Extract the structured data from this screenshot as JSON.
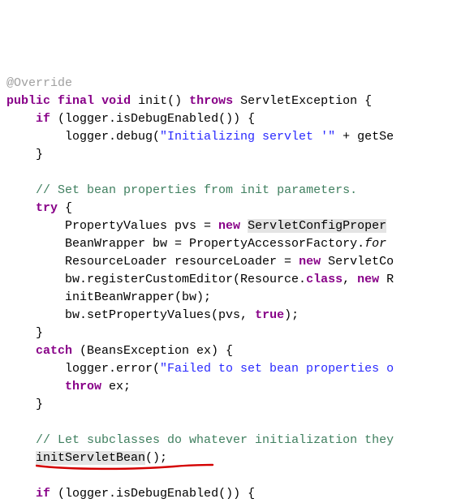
{
  "code": {
    "l1_ann": "@Override",
    "l2_a": "public",
    "l2_b": "final",
    "l2_c": "void",
    "l2_d": " init() ",
    "l2_e": "throws",
    "l2_f": " ServletException {",
    "l3_a": "if",
    "l3_b": " (logger.isDebugEnabled()) {",
    "l4_a": "        logger.debug(",
    "l4_s": "\"Initializing servlet '\"",
    "l4_b": " + getSe",
    "l5": "    }",
    "l7_cmt": "// Set bean properties from init parameters.",
    "l8_a": "try",
    "l8_b": " {",
    "l9_a": "        PropertyValues pvs = ",
    "l9_b": "new",
    "l9_c": " ",
    "l9_d": "ServletConfigProper",
    "l10_a": "        BeanWrapper bw = PropertyAccessorFactory.",
    "l10_b": "for",
    "l11_a": "        ResourceLoader resourceLoader = ",
    "l11_b": "new",
    "l11_c": " ServletCo",
    "l12_a": "        bw.registerCustomEditor(Resource.",
    "l12_b": "class",
    "l12_c": ", ",
    "l12_d": "new",
    "l12_e": " R",
    "l13": "        initBeanWrapper(bw);",
    "l14_a": "        bw.setPropertyValues(pvs, ",
    "l14_b": "true",
    "l14_c": ");",
    "l15": "    }",
    "l16_a": "catch",
    "l16_b": " (BeansException ex) {",
    "l17_a": "        logger.error(",
    "l17_s": "\"Failed to set bean properties o",
    "l18_a": "throw",
    "l18_b": " ex;",
    "l19": "    }",
    "l21_cmt": "// Let subclasses do whatever initialization they",
    "l22_a": "initServletBean",
    "l22_b": "();",
    "l24_a": "if",
    "l24_b": " (logger.isDebugEnabled()) {"
  },
  "colors": {
    "keyword": "#880088",
    "string": "#2a2aff",
    "comment": "#3f7f5f",
    "annotation": "#a0a0a0",
    "highlight_bg": "#e4e4e4",
    "underline": "#d40000"
  }
}
